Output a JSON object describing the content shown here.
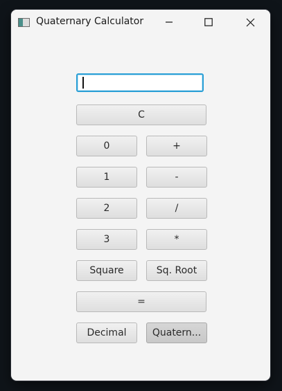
{
  "window": {
    "title": "Quaternary Calculator",
    "controls": {
      "minimize": "minimize-icon",
      "maximize": "maximize-icon",
      "close": "close-icon"
    }
  },
  "display": {
    "value": ""
  },
  "buttons": {
    "clear": "C",
    "digit_0": "0",
    "digit_1": "1",
    "digit_2": "2",
    "digit_3": "3",
    "add": "+",
    "subtract": "-",
    "divide": "/",
    "multiply": "*",
    "square": "Square",
    "sqroot": "Sq. Root",
    "equals": "=",
    "decimal": "Decimal",
    "quaternary": "Quatern..."
  },
  "colors": {
    "focus_border": "#2a9fd6",
    "window_bg": "#f4f4f4",
    "desktop_bg": "#0f1419"
  }
}
